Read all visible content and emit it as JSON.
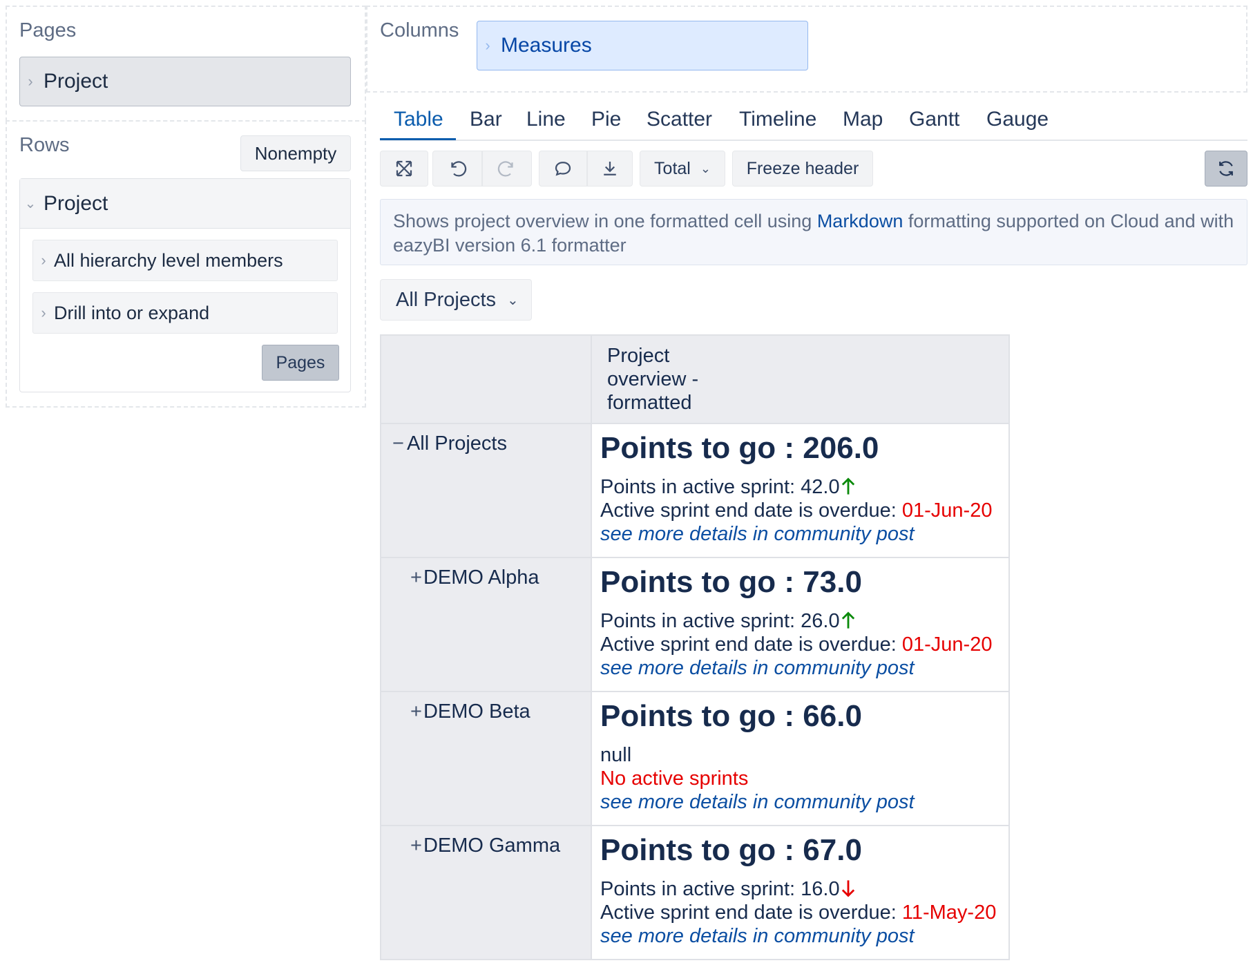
{
  "pages_panel": {
    "title": "Pages",
    "chip": "Project"
  },
  "rows_panel": {
    "title": "Rows",
    "nonempty_label": "Nonempty",
    "project_label": "Project",
    "option_1": "All hierarchy level members",
    "option_2": "Drill into or expand",
    "pages_button": "Pages"
  },
  "columns_panel": {
    "title": "Columns",
    "chip": "Measures"
  },
  "tabs": [
    "Table",
    "Bar",
    "Line",
    "Pie",
    "Scatter",
    "Timeline",
    "Map",
    "Gantt",
    "Gauge"
  ],
  "toolbar": {
    "total_label": "Total",
    "freeze_label": "Freeze header"
  },
  "description": {
    "before": "Shows project overview in one formatted cell using ",
    "link": "Markdown",
    "after": " formatting supported on Cloud and with eazyBI version 6.1 formatter"
  },
  "filter": {
    "selected": "All Projects"
  },
  "table": {
    "column_header": "Project overview - formatted",
    "rows": [
      {
        "label": "All Projects",
        "expander": "−",
        "points_to_go": "Points to go : 206.0",
        "sprint_line": "Points in active sprint: 42.0",
        "trend": "up",
        "overdue_label": "Active sprint end date is overdue: ",
        "overdue_date": "01-Jun-20",
        "link": "see more details in community post"
      },
      {
        "label": "DEMO Alpha",
        "expander": "+",
        "points_to_go": "Points to go : 73.0",
        "sprint_line": "Points in active sprint: 26.0",
        "trend": "up",
        "overdue_label": "Active sprint end date is overdue: ",
        "overdue_date": "01-Jun-20",
        "link": "see more details in community post"
      },
      {
        "label": "DEMO Beta",
        "expander": "+",
        "points_to_go": "Points to go : 66.0",
        "null_line": "null",
        "no_sprints": "No active sprints",
        "link": "see more details in community post"
      },
      {
        "label": "DEMO Gamma",
        "expander": "+",
        "points_to_go": "Points to go : 67.0",
        "sprint_line": "Points in active sprint: 16.0",
        "trend": "down",
        "overdue_label": "Active sprint end date is overdue: ",
        "overdue_date": "11-May-20",
        "link": "see more details in community post"
      }
    ]
  },
  "colors": {
    "accent": "#0b5cad",
    "overdue": "#e60000",
    "trend_up": "#0a8a0a",
    "trend_down": "#e60000",
    "link": "#0b4ea2"
  }
}
